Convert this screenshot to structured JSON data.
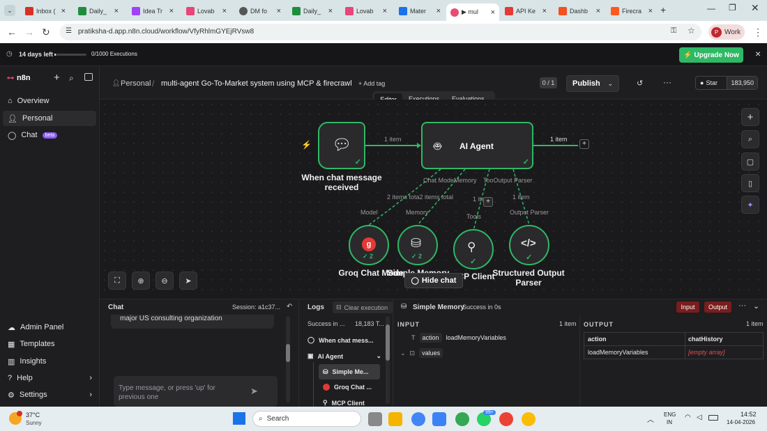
{
  "browser": {
    "tabs": [
      {
        "title": "Inbox (",
        "color": "#d93025"
      },
      {
        "title": "Daily_",
        "color": "#1e8e3e"
      },
      {
        "title": "Idea Tr",
        "color": "#a142f4"
      },
      {
        "title": "Lovab",
        "color": "#e8457a"
      },
      {
        "title": "DM fo",
        "color": "#555555"
      },
      {
        "title": "Daily_",
        "color": "#1e8e3e"
      },
      {
        "title": "Lovab",
        "color": "#e8457a"
      },
      {
        "title": "Mater",
        "color": "#1a73e8"
      },
      {
        "title": "▶ mul",
        "color": "#ea4b71"
      },
      {
        "title": "API Ke",
        "color": "#e53935"
      },
      {
        "title": "Dashb",
        "color": "#f4511e"
      },
      {
        "title": "Firecra",
        "color": "#ff5722"
      }
    ],
    "url": "pratiksha-d.app.n8n.cloud/workflow/VfyRhlmGYEjRVsw8",
    "profile_initial": "P",
    "profile_label": "Work"
  },
  "trial": {
    "days_left": "14 days left",
    "executions": "0/1000 Executions",
    "upgrade_label": "Upgrade Now",
    "close": "×"
  },
  "sidebar": {
    "logo": "n8n",
    "items": [
      {
        "label": "Overview"
      },
      {
        "label": "Personal"
      },
      {
        "label": "Chat",
        "badge": "beta"
      }
    ],
    "bottom_items": [
      {
        "label": "Admin Panel"
      },
      {
        "label": "Templates"
      },
      {
        "label": "Insights"
      },
      {
        "label": "Help"
      },
      {
        "label": "Settings"
      }
    ]
  },
  "header": {
    "breadcrumb_owner": "Personal",
    "workflow_name": "multi-agent Go-To-Market system using MCP & firecrawl",
    "add_tag": "+ Add tag",
    "version": "0 / 1",
    "publish": "Publish",
    "star": "Star",
    "star_count": "183,950",
    "tabs": [
      "Editor",
      "Executions",
      "Evaluations"
    ]
  },
  "canvas": {
    "trigger_label": "When chat message received",
    "agent_label": "AI Agent",
    "edge_label_1": "1 item",
    "edge_label_2": "1 item",
    "ports": [
      "Chat Model",
      "Memory",
      "Tool",
      "Output Parser"
    ],
    "port_labels_concat": "Chat ModeMemory",
    "port_labels_concat2": "TooOutput Parser",
    "items_total": "2 items tota2 items total",
    "tools_item": "1 ite",
    "parser_item": "1 item",
    "sub_labels": [
      "Model",
      "Memory",
      "Tools",
      "Output Parser"
    ],
    "subnodes": [
      {
        "label": "Groq Chat Mode",
        "count": "2"
      },
      {
        "label": "Simple Memory",
        "count": "2"
      },
      {
        "label": "MCP Client",
        "count": ""
      },
      {
        "label": "Structured Output Parser",
        "count": ""
      }
    ],
    "hide_chat": "Hide chat"
  },
  "chat": {
    "title": "Chat",
    "session": "Session: a1c37...",
    "message": "major US consulting organization",
    "placeholder": "Type message, or press 'up' for previous one"
  },
  "logs": {
    "title": "Logs",
    "clear": "Clear execution",
    "summary_status": "Success in ...",
    "summary_tokens": "18,183 T...",
    "items": [
      {
        "label": "When chat mess..."
      },
      {
        "label": "AI Agent"
      },
      {
        "label": "Simple Me..."
      },
      {
        "label": "Groq Chat ..."
      },
      {
        "label": "MCP Client"
      }
    ]
  },
  "detail": {
    "node": "Simple Memory",
    "status": "Success in 0s",
    "input_btn": "Input",
    "output_btn": "Output",
    "input_title": "INPUT",
    "input_count": "1 item",
    "output_title": "OUTPUT",
    "output_count": "1 item",
    "input_rows": [
      {
        "key": "action",
        "value": "loadMemoryVariables"
      },
      {
        "key": "values",
        "value": ""
      }
    ],
    "output_headers": [
      "action",
      "chatHistory"
    ],
    "output_row": [
      "loadMemoryVariables",
      "[empty array]"
    ]
  },
  "taskbar": {
    "temp": "37°C",
    "weather": "Sunny",
    "search": "Search",
    "lang1": "ENG",
    "lang2": "IN",
    "time": "14:52",
    "date": "14-04-2026",
    "notif": "99+"
  },
  "colors": {
    "accent": "#2fb866",
    "brand": "#ea4b71",
    "upgrade": "#2fb866"
  }
}
